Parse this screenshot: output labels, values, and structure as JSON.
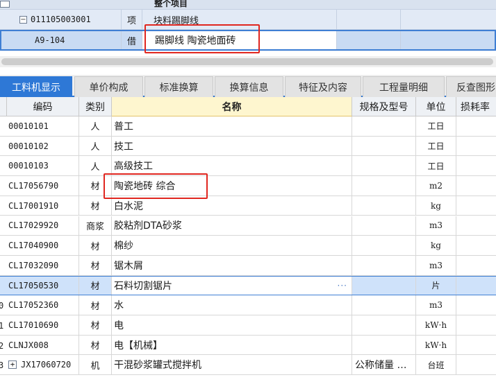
{
  "top_grid": {
    "header_label": "整个项目",
    "rows": [
      {
        "code": "011105003001",
        "type": "项",
        "name": "块料踢脚线",
        "tree": "−"
      },
      {
        "code": "A9-104",
        "type": "借",
        "name": "踢脚线 陶瓷地面砖"
      }
    ]
  },
  "tabs": [
    {
      "label": "工料机显示",
      "active": true
    },
    {
      "label": "单价构成",
      "active": false
    },
    {
      "label": "标准换算",
      "active": false
    },
    {
      "label": "换算信息",
      "active": false
    },
    {
      "label": "特征及内容",
      "active": false
    },
    {
      "label": "工程量明细",
      "active": false
    },
    {
      "label": "反查图形",
      "active": false
    }
  ],
  "columns": {
    "code": "编码",
    "category": "类别",
    "name": "名称",
    "spec": "规格及型号",
    "unit": "单位",
    "loss": "损耗率"
  },
  "rows": [
    {
      "num": "",
      "code": "00010101",
      "cat": "人",
      "name": "普工",
      "spec": "",
      "unit": "工日"
    },
    {
      "num": "",
      "code": "00010102",
      "cat": "人",
      "name": "技工",
      "spec": "",
      "unit": "工日"
    },
    {
      "num": "",
      "code": "00010103",
      "cat": "人",
      "name": "高级技工",
      "spec": "",
      "unit": "工日"
    },
    {
      "num": "",
      "code": "CL17056790",
      "cat": "材",
      "name": "陶瓷地砖 综合",
      "spec": "",
      "unit": "m2"
    },
    {
      "num": "",
      "code": "CL17001910",
      "cat": "材",
      "name": "白水泥",
      "spec": "",
      "unit": "kg"
    },
    {
      "num": "",
      "code": "CL17029920",
      "cat": "商浆",
      "name": "胶粘剂DTA砂浆",
      "spec": "",
      "unit": "m3"
    },
    {
      "num": "",
      "code": "CL17040900",
      "cat": "材",
      "name": "棉纱",
      "spec": "",
      "unit": "kg"
    },
    {
      "num": "",
      "code": "CL17032090",
      "cat": "材",
      "name": "锯木屑",
      "spec": "",
      "unit": "m3"
    },
    {
      "num": "",
      "code": "CL17050530",
      "cat": "材",
      "name": "石料切割锯片",
      "spec": "",
      "unit": "片",
      "ellipsis": "···"
    },
    {
      "num": "0",
      "code": "CL17052360",
      "cat": "材",
      "name": "水",
      "spec": "",
      "unit": "m3"
    },
    {
      "num": "1",
      "code": "CL17010690",
      "cat": "材",
      "name": "电",
      "spec": "",
      "unit": "kW·h"
    },
    {
      "num": "2",
      "code": "CLNJX008",
      "cat": "材",
      "name": "电【机械】",
      "spec": "",
      "unit": "kW·h"
    },
    {
      "num": "3",
      "code": "JX17060720",
      "cat": "机",
      "name": "干混砂浆罐式搅拌机",
      "spec": "公称储量 …",
      "unit": "台班",
      "tree": "+"
    }
  ],
  "colors": {
    "tab_active": "#2e78d6",
    "highlight_box": "#e0261f",
    "selected_row": "#cfe2fa",
    "name_header": "#fef6cf"
  }
}
